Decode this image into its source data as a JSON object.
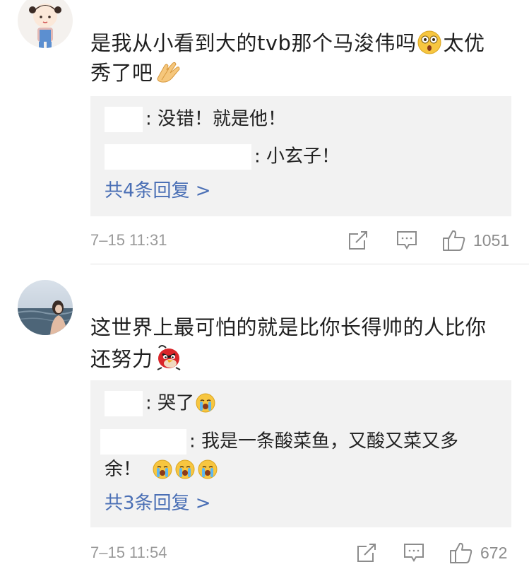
{
  "comments": [
    {
      "text_part1": "是我从小看到大的tvb那个马浚伟吗",
      "text_part2": "太优",
      "text_part3": "秀了吧",
      "emoji_1": "astonished-face-icon",
      "emoji_2": "clapping-hands-icon",
      "replies": [
        {
          "text": ": 没错！就是他！"
        },
        {
          "text": ": 小玄子！"
        }
      ],
      "more_replies_label": "共4条回复 >",
      "timestamp": "7–15 11:31",
      "like_count": "1051"
    },
    {
      "text_part1": "这世界上最可怕的就是比你长得帅的人比你",
      "text_part2": "还努力",
      "emoji_1": "angry-red-bird-icon",
      "replies": [
        {
          "text": ": 哭了"
        },
        {
          "text": ": 我是一条酸菜鱼，又酸又菜又多",
          "text_cont": "余！"
        }
      ],
      "more_replies_label": "共3条回复 >",
      "timestamp": "7–15 11:54",
      "like_count": "672"
    }
  ],
  "colors": {
    "reply_background": "#f2f2f2",
    "link_blue": "#4a6fb5",
    "meta_gray": "#9a9a9a",
    "icon_gray": "#8c8c8c"
  }
}
